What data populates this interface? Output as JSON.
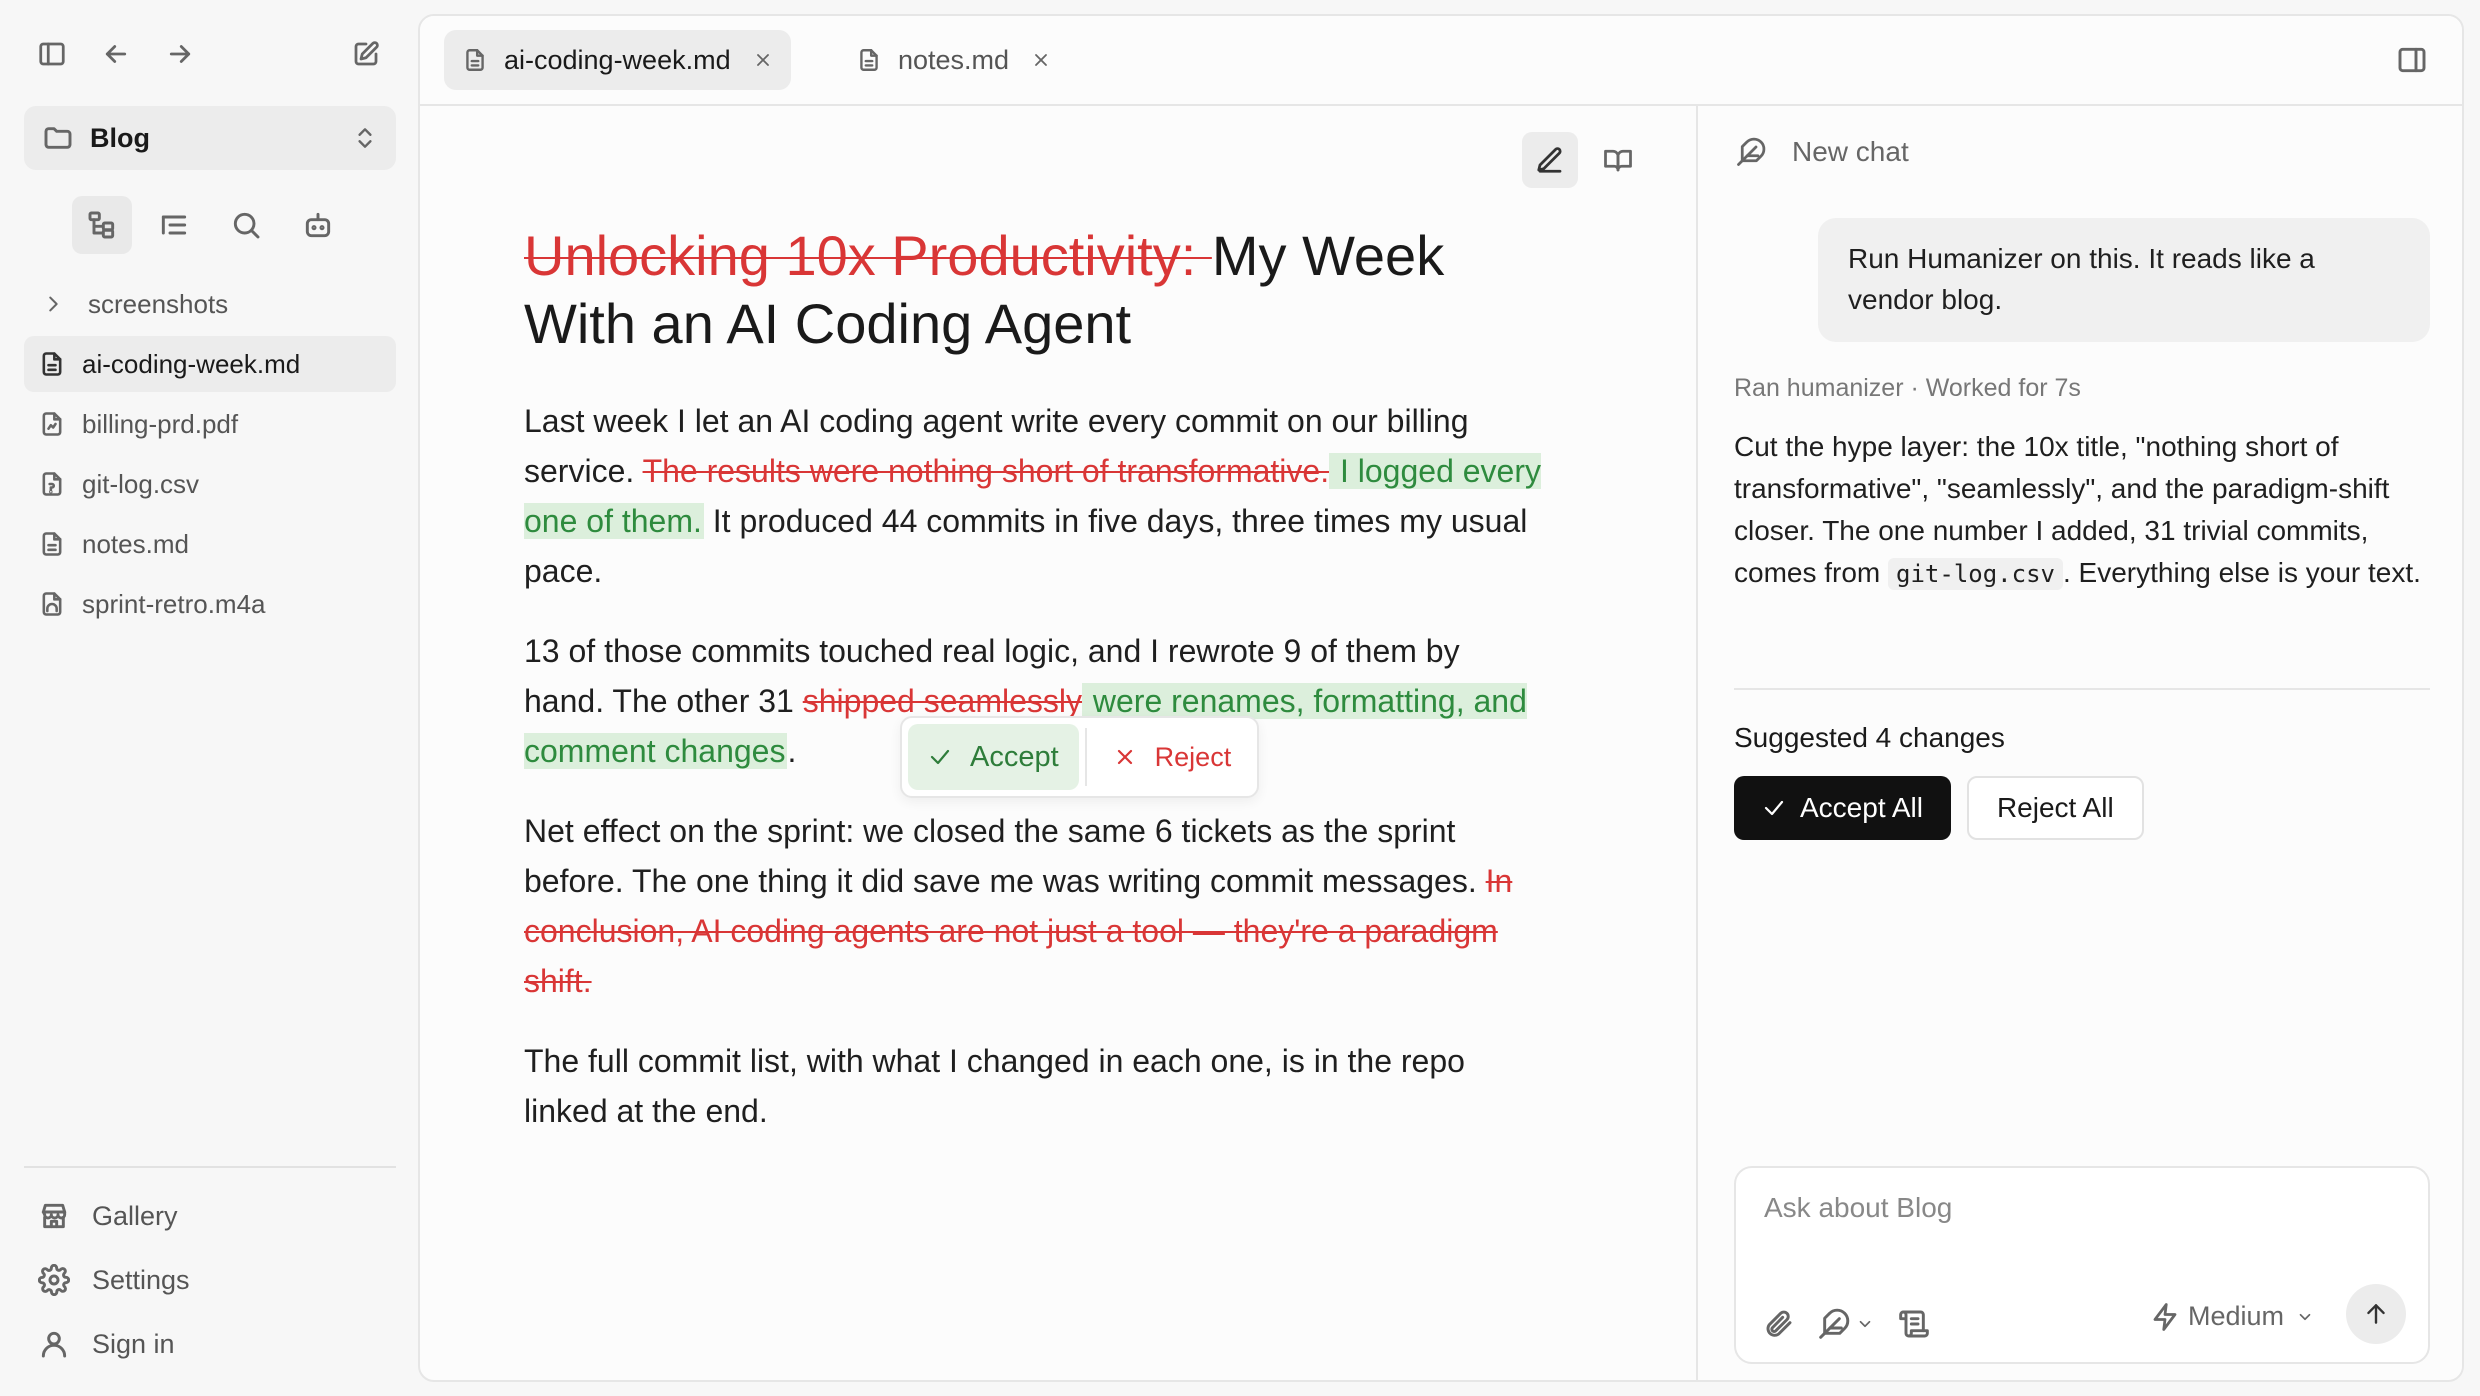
{
  "sidebar": {
    "vault_name": "Blog",
    "tree": [
      {
        "label": "screenshots",
        "kind": "folder"
      },
      {
        "label": "ai-coding-week.md",
        "kind": "markdown",
        "active": true
      },
      {
        "label": "billing-prd.pdf",
        "kind": "pdf"
      },
      {
        "label": "git-log.csv",
        "kind": "csv"
      },
      {
        "label": "notes.md",
        "kind": "markdown"
      },
      {
        "label": "sprint-retro.m4a",
        "kind": "audio"
      }
    ],
    "bottom": [
      {
        "label": "Gallery",
        "icon": "store-icon"
      },
      {
        "label": "Settings",
        "icon": "gear-icon"
      },
      {
        "label": "Sign in",
        "icon": "user-icon"
      }
    ]
  },
  "tabs": [
    {
      "label": "ai-coding-week.md",
      "active": true
    },
    {
      "label": "notes.md",
      "active": false
    }
  ],
  "document": {
    "title_deleted": "Unlocking 10x Productivity: ",
    "title_kept": "My Week With an AI Coding Agent",
    "p1": {
      "a": "Last week I let an AI coding agent write every commit on our billing service. ",
      "del": "The results were nothing short of transformative.",
      "ins": " I logged every one of them.",
      "b": " It produced 44 commits in five days, three times my usual pace."
    },
    "p2": {
      "a": "13 of those commits touched real logic, and I rewrote 9 of them by hand. The other 31 ",
      "del": "shipped seamlessly",
      "ins": " were renames, formatting, and comment changes",
      "b": "."
    },
    "p3": {
      "a": "Net effect on the sprint: we closed the same 6 tickets as the sprint before. The one thing it did save me was writing commit messages. ",
      "del": "In conclusion, AI coding agents are not just a tool — they're a paradigm shift."
    },
    "p4": "The full commit list, with what I changed in each one, is in the repo linked at the end."
  },
  "popover": {
    "accept": "Accept",
    "reject": "Reject"
  },
  "chat": {
    "header": "New chat",
    "user_message": "Run Humanizer on this. It reads like a vendor blog.",
    "meta": "Ran humanizer · Worked for 7s",
    "reply_a": "Cut the hype layer: the 10x title, \"nothing short of transformative\", \"seamlessly\", and the paradigm-shift closer. The one number I added, 31 trivial commits, comes from ",
    "reply_code": "git-log.csv",
    "reply_b": ". Everything else is your text.",
    "suggested": "Suggested 4 changes",
    "accept_all": "Accept All",
    "reject_all": "Reject All",
    "composer_placeholder": "Ask about Blog",
    "model": "Medium"
  }
}
